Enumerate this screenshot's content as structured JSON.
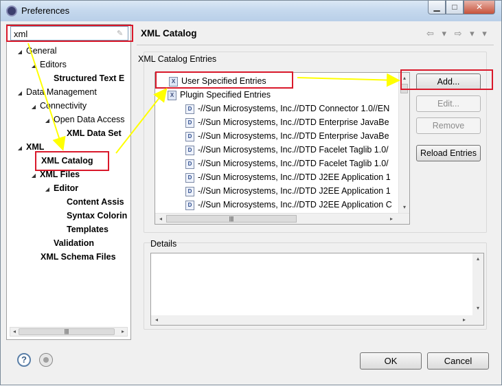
{
  "window": {
    "title": "Preferences",
    "min": "▁",
    "max": "□",
    "close": "✕"
  },
  "search": {
    "value": "xml",
    "clear": "✎"
  },
  "tree": [
    {
      "label": "General",
      "bold": false,
      "twisty": "◢"
    },
    {
      "label": "Editors",
      "bold": false,
      "twisty": "◢"
    },
    {
      "label": "Structured Text E",
      "bold": true,
      "twisty": ""
    },
    {
      "label": "Data Management",
      "bold": false,
      "twisty": "◢"
    },
    {
      "label": "Connectivity",
      "bold": false,
      "twisty": "◢"
    },
    {
      "label": "Open Data Access",
      "bold": false,
      "twisty": "◢"
    },
    {
      "label": "XML Data Set",
      "bold": true,
      "twisty": ""
    },
    {
      "label": "XML",
      "bold": true,
      "twisty": "◢"
    },
    {
      "label": "XML Catalog",
      "bold": true,
      "twisty": ""
    },
    {
      "label": "XML Files",
      "bold": true,
      "twisty": "◢"
    },
    {
      "label": "Editor",
      "bold": true,
      "twisty": "◢"
    },
    {
      "label": "Content Assis",
      "bold": true,
      "twisty": ""
    },
    {
      "label": "Syntax Colorin",
      "bold": true,
      "twisty": ""
    },
    {
      "label": "Templates",
      "bold": true,
      "twisty": ""
    },
    {
      "label": "Validation",
      "bold": true,
      "twisty": ""
    },
    {
      "label": "XML Schema Files",
      "bold": true,
      "twisty": ""
    }
  ],
  "page": {
    "title": "XML Catalog",
    "nav": "⇦ ▾ ⇨ ▾ ▾"
  },
  "catalog": {
    "label": "XML Catalog Entries",
    "rows": [
      {
        "label": "User Specified Entries",
        "kind": "folder",
        "twisty": ""
      },
      {
        "label": "Plugin Specified Entries",
        "kind": "folder",
        "twisty": "◢"
      },
      {
        "label": "-//Sun Microsystems, Inc.//DTD Connector 1.0//EN",
        "kind": "dtd"
      },
      {
        "label": "-//Sun Microsystems, Inc.//DTD Enterprise JavaBe",
        "kind": "dtd"
      },
      {
        "label": "-//Sun Microsystems, Inc.//DTD Enterprise JavaBe",
        "kind": "dtd"
      },
      {
        "label": "-//Sun Microsystems, Inc.//DTD Facelet Taglib 1.0/",
        "kind": "dtd"
      },
      {
        "label": "-//Sun Microsystems, Inc.//DTD Facelet Taglib 1.0/",
        "kind": "dtd"
      },
      {
        "label": "-//Sun Microsystems, Inc.//DTD J2EE Application 1",
        "kind": "dtd"
      },
      {
        "label": "-//Sun Microsystems, Inc.//DTD J2EE Application 1",
        "kind": "dtd"
      },
      {
        "label": "-//Sun Microsystems, Inc.//DTD J2EE Application C",
        "kind": "dtd"
      }
    ],
    "buttons": {
      "add": "Add...",
      "edit": "Edit...",
      "remove": "Remove",
      "reload": "Reload Entries"
    }
  },
  "details": {
    "label": "Details"
  },
  "footer": {
    "ok": "OK",
    "cancel": "Cancel",
    "help": "?"
  },
  "colors": {
    "annotation_red": "#d9182a",
    "annotation_yellow": "#ffff00"
  }
}
